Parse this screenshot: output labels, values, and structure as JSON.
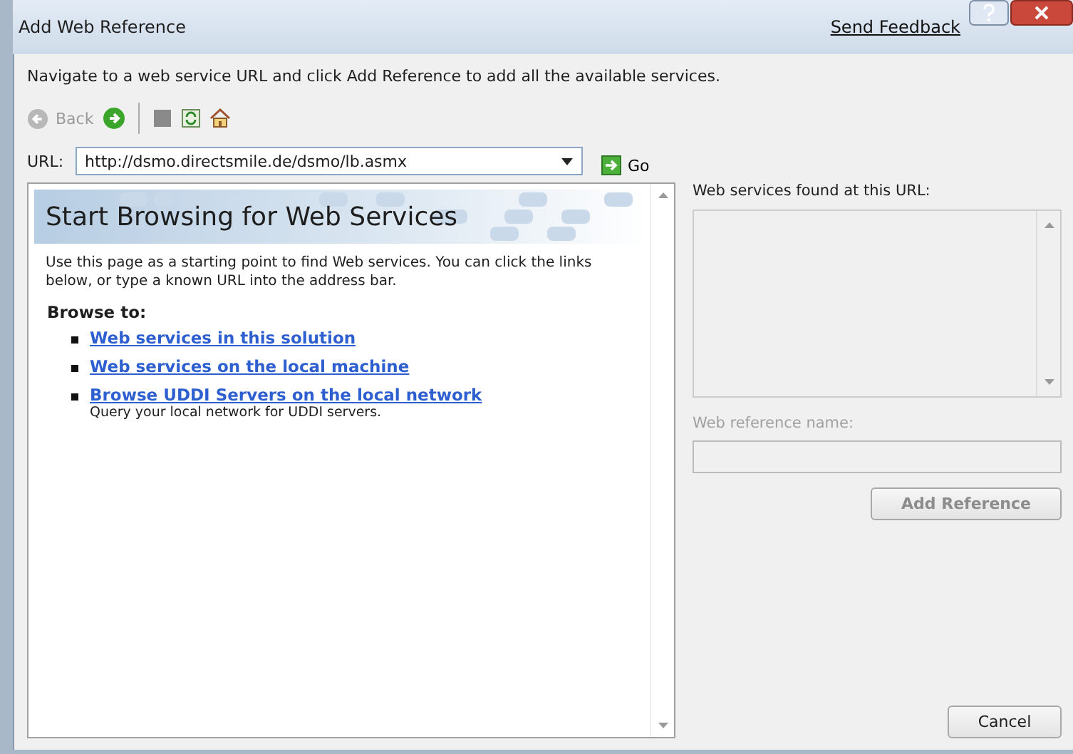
{
  "window": {
    "title": "Add Web Reference",
    "feedback_link": "Send Feedback"
  },
  "instruction": "Navigate to a web service URL and click Add Reference to add all the available services.",
  "toolbar": {
    "back": {
      "label": "Back",
      "disabled": true
    }
  },
  "url": {
    "label": "URL:",
    "value": "http://dsmo.directsmile.de/dsmo/lb.asmx",
    "go_label": "Go"
  },
  "browser": {
    "heading": "Start Browsing for Web Services",
    "intro": "Use this page as a starting point to find Web services. You can click the links below, or type a known URL into the address bar.",
    "browse_label": "Browse to:",
    "links": [
      {
        "text": "Web services in this solution"
      },
      {
        "text": "Web services on the local machine"
      },
      {
        "text": "Browse UDDI Servers on the local network",
        "note": "Query your local network for UDDI servers."
      }
    ]
  },
  "services": {
    "label": "Web services found at this URL:"
  },
  "reference_name": {
    "label": "Web reference name:",
    "disabled": true
  },
  "buttons": [
    {
      "label": "Add Reference",
      "disabled": true
    },
    {
      "label": "Cancel",
      "disabled": false
    }
  ]
}
